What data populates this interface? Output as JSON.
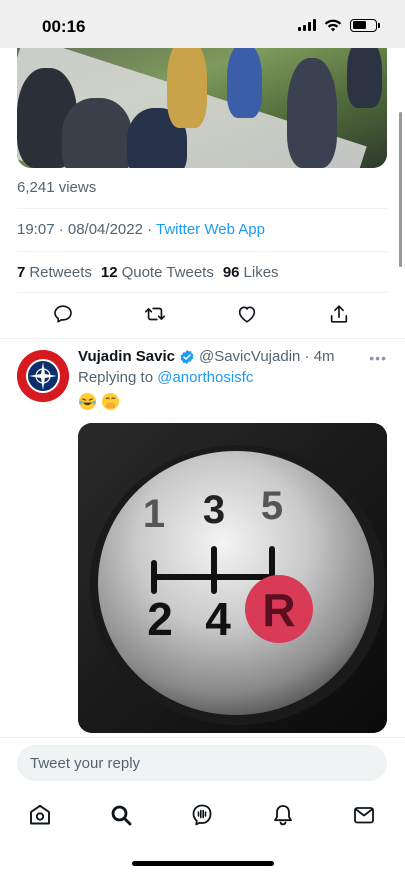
{
  "status_bar": {
    "time": "00:16"
  },
  "tweet": {
    "views": "6,241 views",
    "timestamp": "19:07 · 08/04/2022 · ",
    "source": "Twitter Web App",
    "stats": {
      "retweets_count": "7",
      "retweets_label": "Retweets",
      "quote_count": "12",
      "quote_label": "Quote Tweets",
      "likes_count": "96",
      "likes_label": "Likes"
    }
  },
  "reply": {
    "author_name": "Vujadin Savic",
    "author_handle": "@SavicVujadin · 4m",
    "replying_prefix": "Replying to ",
    "replying_mention": "@anorthosisfc",
    "media": {
      "gear_top": [
        "1",
        "3",
        "5"
      ],
      "gear_bottom": [
        "2",
        "4"
      ],
      "reverse": "R"
    }
  },
  "composer": {
    "placeholder": "Tweet your reply"
  },
  "icons": {
    "reply": "comment-icon",
    "retweet": "retweet-icon",
    "like": "heart-icon",
    "share": "share-icon",
    "home": "home-icon",
    "search": "search-icon",
    "spaces": "spaces-icon",
    "notifications": "bell-icon",
    "messages": "mail-icon"
  },
  "colors": {
    "link": "#1d9bf0",
    "secondary": "#536471",
    "verified": "#1d9bf0"
  }
}
